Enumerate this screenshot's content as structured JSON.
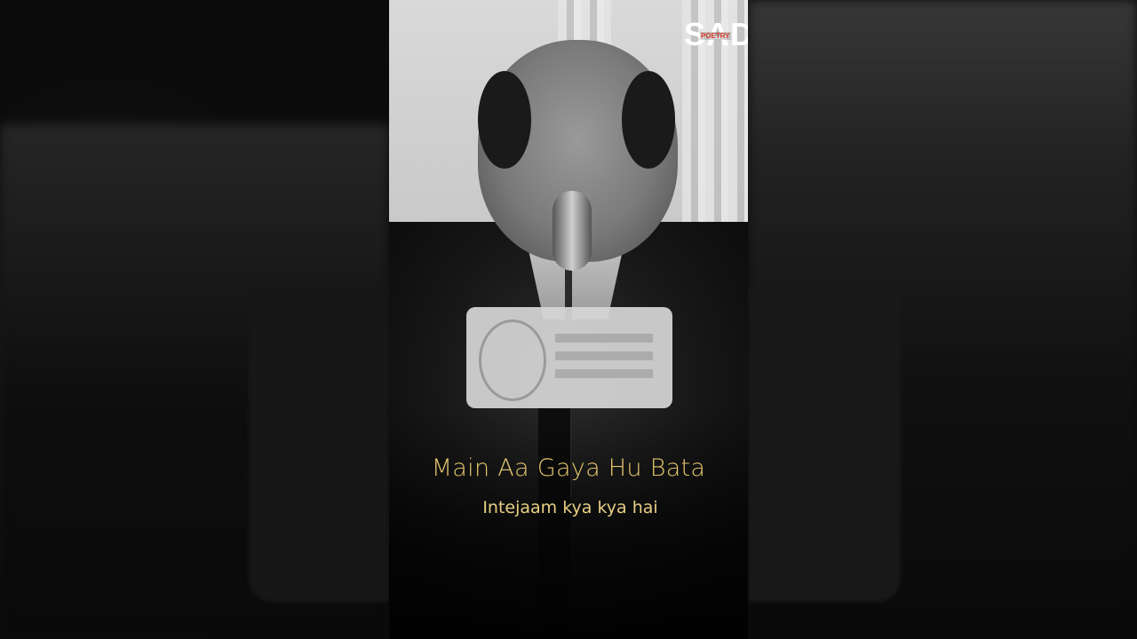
{
  "watermark": {
    "logo_text": "SAD",
    "logo_subtext": "POETRY"
  },
  "captions": {
    "line1": "Main Aa Gaya Hu Bata",
    "line2": "Intejaam kya kya hai"
  },
  "colors": {
    "caption": "#e3c56f",
    "logo_accent": "#d23b2a"
  }
}
